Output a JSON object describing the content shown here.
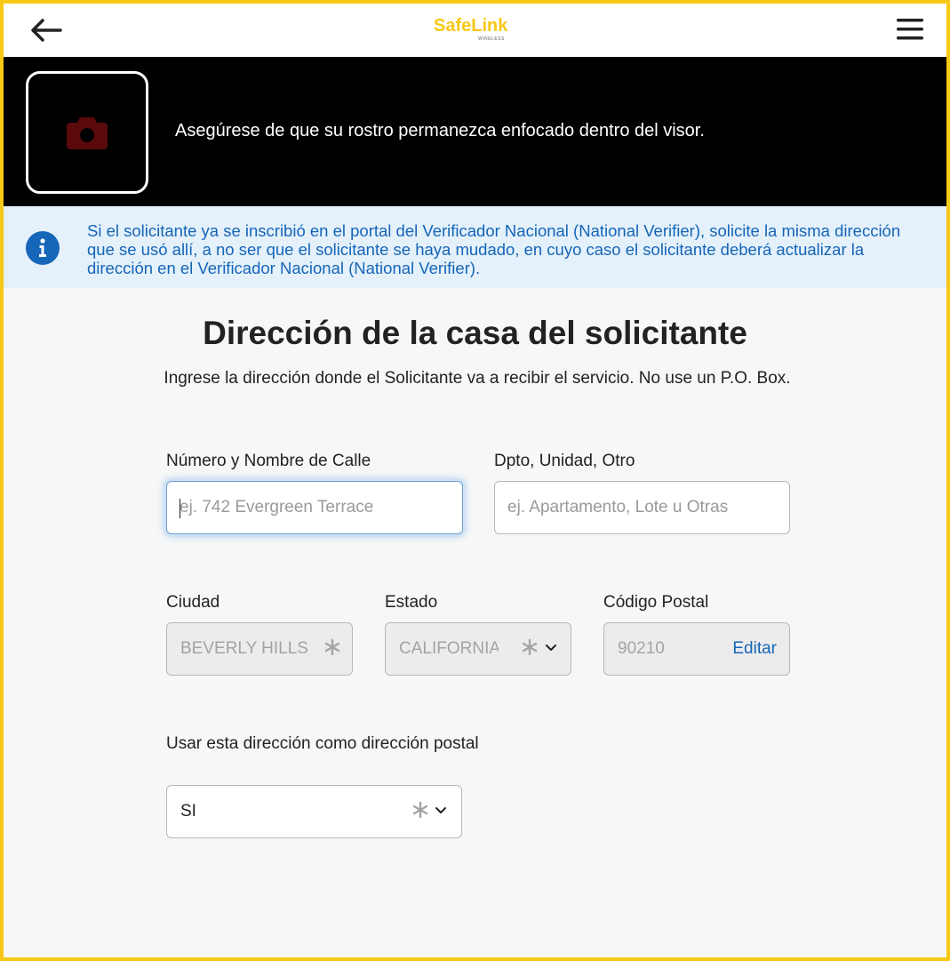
{
  "header": {
    "logo_main": "SafeLink",
    "logo_sub": "WIRELESS"
  },
  "camera": {
    "message": "Asegúrese de que su rostro permanezca enfocado dentro del visor."
  },
  "info": {
    "text": "Si el solicitante ya se inscribió en el portal del Verificador Nacional (National Verifier), solicite la misma dirección que se usó allí, a no ser que el solicitante se haya mudado, en cuyo caso el solicitante deberá actualizar la dirección en el Verificador Nacional (National Verifier)."
  },
  "form": {
    "title": "Dirección de la casa del solicitante",
    "subtitle": "Ingrese la dirección donde el Solicitante va a recibir el servicio. No use un P.O. Box.",
    "street": {
      "label": "Número y Nombre de Calle",
      "placeholder": "ej. 742 Evergreen Terrace",
      "value": ""
    },
    "unit": {
      "label": "Dpto, Unidad, Otro",
      "placeholder": "ej. Apartamento, Lote u Otras",
      "value": ""
    },
    "city": {
      "label": "Ciudad",
      "value": "BEVERLY HILLS"
    },
    "state": {
      "label": "Estado",
      "value": "CALIFORNIA"
    },
    "zip": {
      "label": "Código Postal",
      "value": "90210",
      "edit_label": "Editar"
    },
    "mailing": {
      "label": "Usar esta dirección como dirección postal",
      "value": "SI"
    }
  },
  "colors": {
    "brand_yellow": "#f7c815",
    "link_blue": "#1565b8",
    "camera_red": "#5a0a0a",
    "info_bg": "#e4f1fb"
  }
}
